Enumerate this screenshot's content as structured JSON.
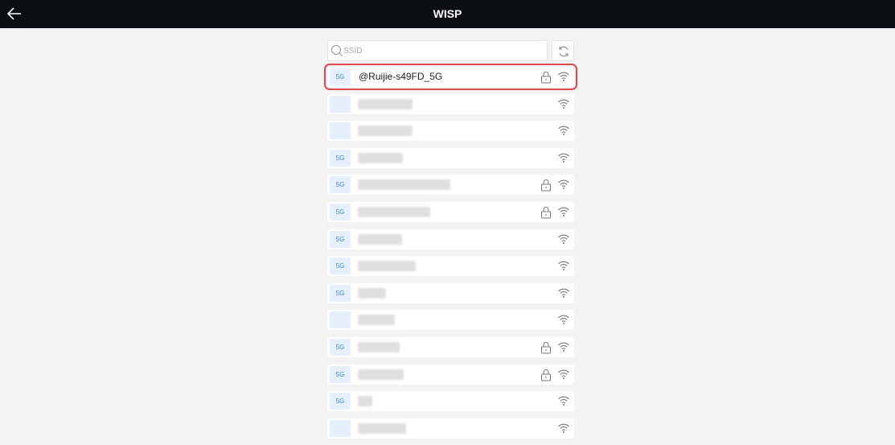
{
  "header": {
    "title": "WISP"
  },
  "search": {
    "placeholder": "SSID",
    "value": ""
  },
  "networks": [
    {
      "band": "5G",
      "ssid": "@Ruijie-s49FD_5G",
      "locked": true,
      "selected": true
    },
    {
      "band": "",
      "ssid": "",
      "locked": false
    },
    {
      "band": "",
      "ssid": "",
      "locked": false
    },
    {
      "band": "5G",
      "ssid": "",
      "locked": false
    },
    {
      "band": "5G",
      "ssid": "",
      "locked": true
    },
    {
      "band": "5G",
      "ssid": "",
      "locked": true
    },
    {
      "band": "5G",
      "ssid": "",
      "locked": false
    },
    {
      "band": "5G",
      "ssid": "",
      "locked": false
    },
    {
      "band": "5G",
      "ssid": "",
      "locked": false
    },
    {
      "band": "",
      "ssid": "",
      "locked": false
    },
    {
      "band": "5G",
      "ssid": "",
      "locked": true
    },
    {
      "band": "5G",
      "ssid": "",
      "locked": true
    },
    {
      "band": "5G",
      "ssid": "",
      "locked": false
    },
    {
      "band": "",
      "ssid": "",
      "locked": false
    }
  ],
  "colors": {
    "header_bg": "#0c0f14",
    "band_badge": "#3d86d6",
    "selection": "#e0474e"
  },
  "icons": [
    "back-arrow-icon",
    "search-icon",
    "refresh-icon",
    "lock-icon",
    "wifi-icon"
  ]
}
